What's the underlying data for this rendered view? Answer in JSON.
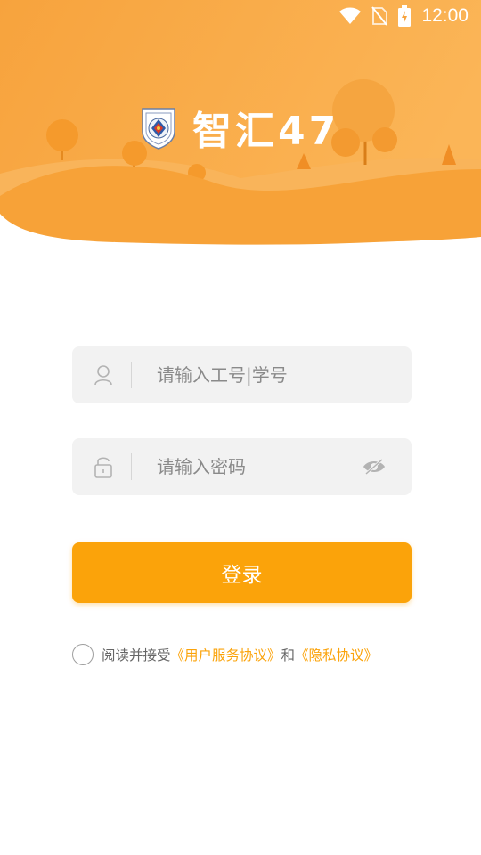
{
  "status_bar": {
    "time": "12:00",
    "icons": [
      "wifi-icon",
      "no-sim-icon",
      "battery-charging-icon"
    ]
  },
  "brand": {
    "title": "智汇47",
    "logo_icon": "school-shield-logo"
  },
  "login_form": {
    "username_placeholder": "请输入工号|学号",
    "username_icon": "user-icon",
    "password_placeholder": "请输入密码",
    "password_icon": "lock-icon",
    "visibility_icon": "eye-hidden-icon",
    "submit_label": "登录"
  },
  "agreement": {
    "prefix": "阅读并接受",
    "terms_link": "《用户服务协议》",
    "conjunction": "和",
    "privacy_link": "《隐私协议》"
  },
  "colors": {
    "accent": "#fba30a",
    "header_orange": "#f7a13c",
    "field_bg": "#f2f2f2"
  }
}
